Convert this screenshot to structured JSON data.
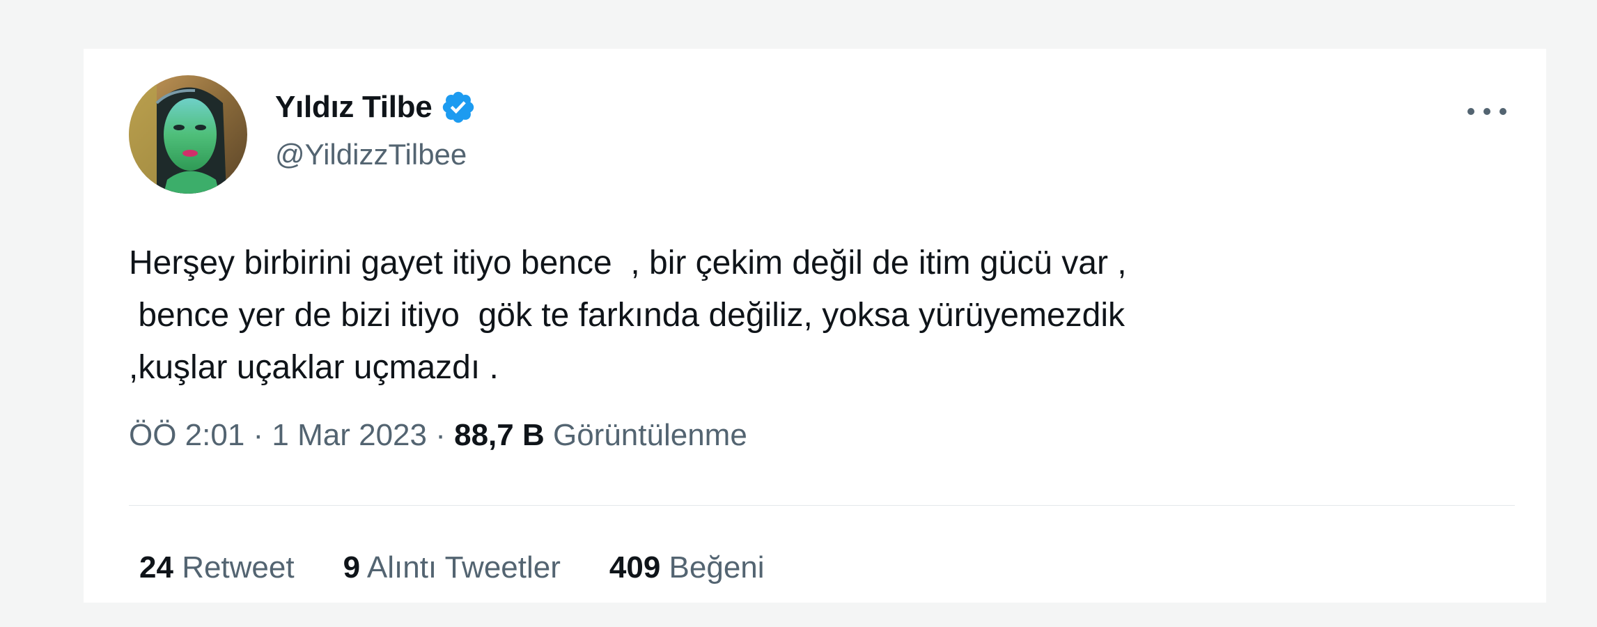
{
  "author": {
    "display_name": "Yıldız Tilbe",
    "handle": "@YildizzTilbee",
    "verified": true
  },
  "tweet": {
    "text_lines": [
      "Herşey birbirini gayet itiyo bence  , bir çekim değil de itim gücü var ,",
      " bence yer de bizi itiyo  gök te farkında değiliz, yoksa yürüyemezdik",
      ",kuşlar uçaklar uçmazdı ."
    ]
  },
  "meta": {
    "time": "ÖÖ 2:01",
    "separator": " · ",
    "date": "1 Mar 2023",
    "views_count": "88,7 B",
    "views_label": "Görüntülenme"
  },
  "stats": {
    "retweets": {
      "count": "24",
      "label": "Retweet"
    },
    "quotes": {
      "count": "9",
      "label": "Alıntı Tweetler"
    },
    "likes": {
      "count": "409",
      "label": "Beğeni"
    }
  },
  "colors": {
    "verified_blue": "#1d9bf0",
    "text_primary": "#0f1419",
    "text_secondary": "#536471",
    "background": "#f4f5f5"
  },
  "icons": {
    "verified": "verified-badge-icon",
    "more": "more-options-icon"
  }
}
